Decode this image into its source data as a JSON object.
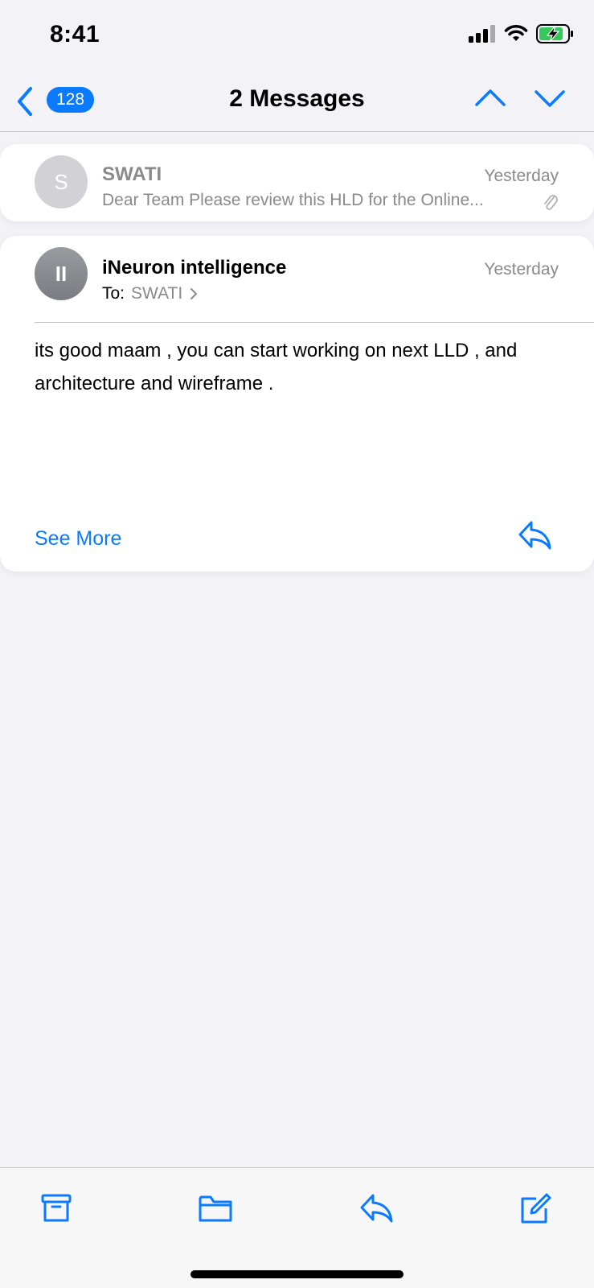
{
  "status_bar": {
    "time": "8:41",
    "icons": [
      "signal-icon",
      "wifi-icon",
      "battery-charging-icon"
    ]
  },
  "nav": {
    "badge_count": "128",
    "title": "2 Messages",
    "icons": [
      "back-chevron-icon",
      "chevron-up-icon",
      "chevron-down-icon"
    ]
  },
  "messages": [
    {
      "avatar_initial": "S",
      "sender": "SWATI",
      "date": "Yesterday",
      "preview": "Dear Team Please review this HLD for the Online...",
      "has_attachment": true
    },
    {
      "avatar_initial": "II",
      "sender": "iNeuron intelligence",
      "date": "Yesterday",
      "to_label": "To:",
      "to_value": "SWATI",
      "body": "its good maam , you can start working on next LLD , and architecture and wireframe .",
      "see_more": "See More"
    }
  ],
  "toolbar": {
    "icons": [
      "archive-icon",
      "folder-icon",
      "reply-icon",
      "compose-icon"
    ]
  },
  "colors": {
    "accent": "#0a7aff",
    "secondary_text": "#8a8a8e",
    "background": "#f2f2f7"
  }
}
